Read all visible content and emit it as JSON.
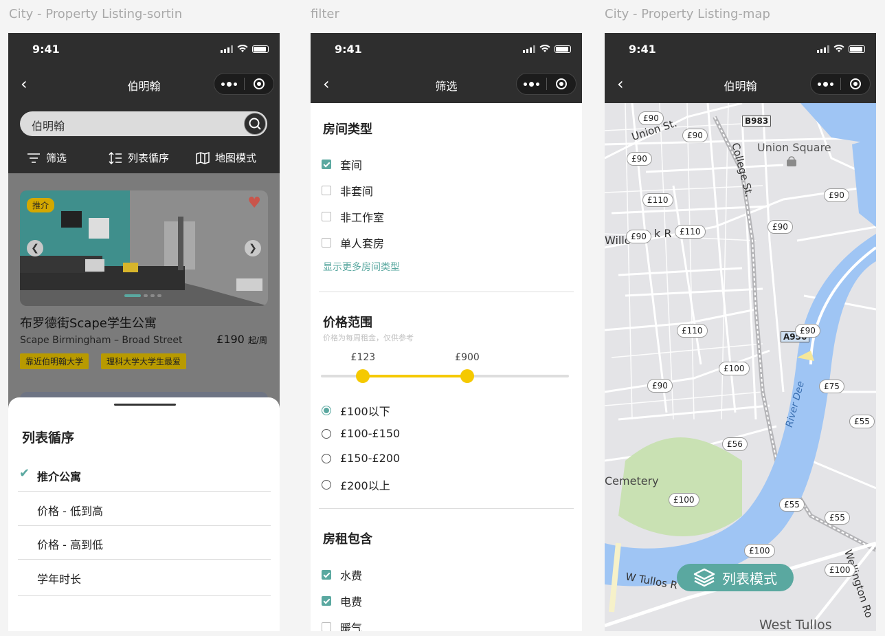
{
  "frames": {
    "sorting": "City - Property Listing-sortin",
    "filter": "filter",
    "map": "City - Property Listing-map"
  },
  "status_bar": {
    "time": "9:41"
  },
  "sorting": {
    "nav_title": "伯明翰",
    "search_value": "伯明翰",
    "toolbar": {
      "filter": "筛选",
      "sort": "列表循序",
      "map_mode": "地图模式"
    },
    "card": {
      "badge": "推介",
      "title": "布罗德街Scape学生公寓",
      "subtitle": "Scape Birmingham – Broad Street",
      "price": "£190",
      "price_unit": "起/周",
      "tags": [
        "靠近伯明翰大学",
        "理科大学大学生最爱"
      ]
    },
    "sheet": {
      "title": "列表循序",
      "options": [
        {
          "label": "推介公寓",
          "selected": true
        },
        {
          "label": "价格 - 低到高",
          "selected": false
        },
        {
          "label": "价格 - 高到低",
          "selected": false
        },
        {
          "label": "学年时长",
          "selected": false
        }
      ]
    }
  },
  "filter": {
    "nav_title": "筛选",
    "room_type": {
      "title": "房间类型",
      "options": [
        {
          "label": "套间",
          "checked": true
        },
        {
          "label": "非套间",
          "checked": false
        },
        {
          "label": "非工作室",
          "checked": false
        },
        {
          "label": "单人套房",
          "checked": false
        }
      ],
      "more": "显示更多房间类型"
    },
    "price": {
      "title": "价格范围",
      "hint": "价格为每周租金，仅供参考",
      "min_label": "£123",
      "max_label": "£900",
      "min_fraction": 0.17,
      "max_fraction": 0.59,
      "options": [
        {
          "label": "£100以下",
          "selected": true
        },
        {
          "label": "£100-£150",
          "selected": false
        },
        {
          "label": "£150-£200",
          "selected": false
        },
        {
          "label": "£200以上",
          "selected": false
        }
      ]
    },
    "includes": {
      "title": "房租包含",
      "options": [
        {
          "label": "水费",
          "checked": true
        },
        {
          "label": "电费",
          "checked": true
        },
        {
          "label": "暖气",
          "checked": false
        }
      ]
    }
  },
  "map": {
    "nav_title": "伯明翰",
    "labels": {
      "union_st": "Union St.",
      "college_st": "College St.",
      "union_square": "Union Square",
      "willow": "Willo",
      "willow_end": "k R",
      "river": "River Dee",
      "cemetery": "Cemetery",
      "w_tullos": "W Tullos R",
      "wellington": "Wellington Ro",
      "west_tullos": "West Tullos",
      "b983": "B983",
      "a956": "A956"
    },
    "pins": [
      "£90",
      "£90",
      "£90",
      "£110",
      "£90",
      "£110",
      "£90",
      "£90",
      "£110",
      "£90",
      "£100",
      "£90",
      "£75",
      "£55",
      "£56",
      "£100",
      "£55",
      "£55",
      "£100",
      "£100"
    ],
    "list_mode_button": "列表模式"
  },
  "colors": {
    "accent": "#5aa8a0",
    "slider": "#f5c900",
    "dark": "#2e2e2e"
  }
}
